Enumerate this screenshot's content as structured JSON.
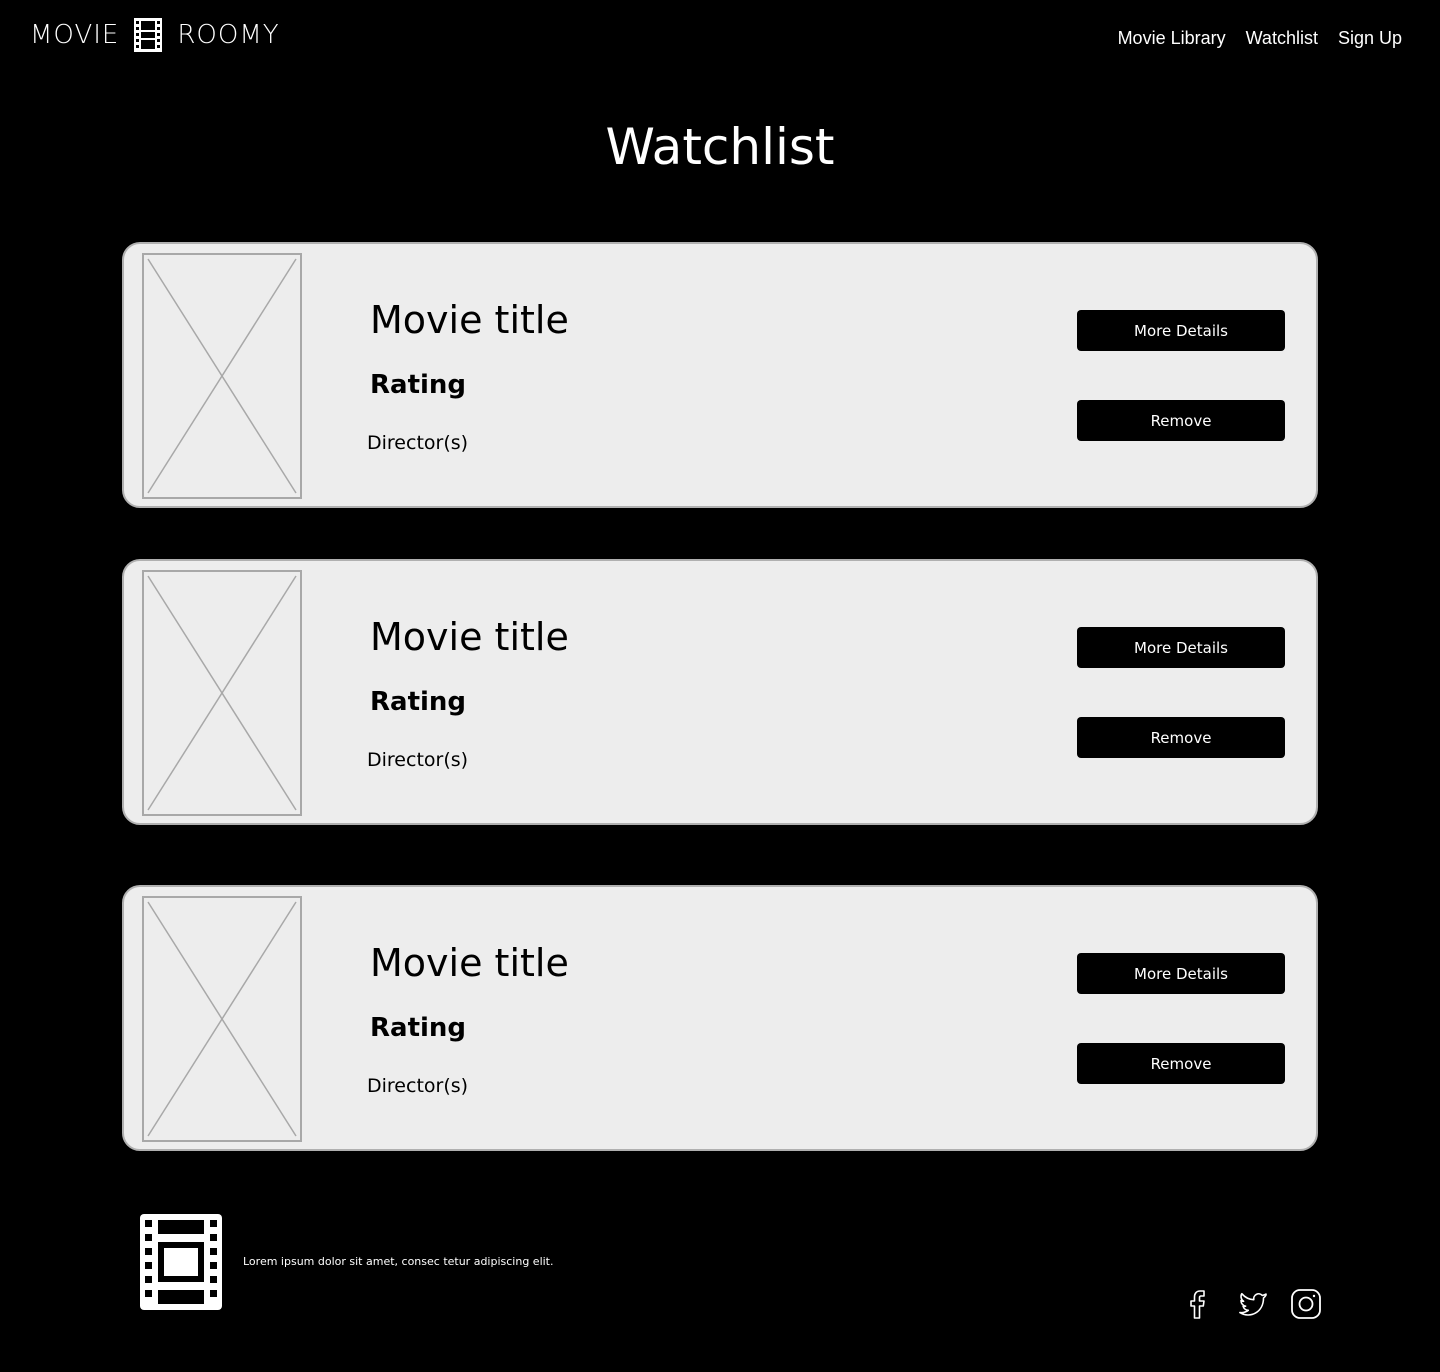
{
  "header": {
    "logo_left": "MOVIE",
    "logo_right": "ROOMY",
    "nav": [
      {
        "label": "Movie Library"
      },
      {
        "label": "Watchlist"
      },
      {
        "label": "Sign Up"
      }
    ]
  },
  "page": {
    "title": "Watchlist"
  },
  "movies": [
    {
      "title": "Movie title",
      "rating": "Rating",
      "directors": "Director(s)",
      "details_label": "More Details",
      "remove_label": "Remove"
    },
    {
      "title": "Movie title",
      "rating": "Rating",
      "directors": "Director(s)",
      "details_label": "More Details",
      "remove_label": "Remove"
    },
    {
      "title": "Movie title",
      "rating": "Rating",
      "directors": "Director(s)",
      "details_label": "More Details",
      "remove_label": "Remove"
    }
  ],
  "footer": {
    "text": "Lorem ipsum dolor sit amet, consec tetur adipiscing elit.",
    "socials": [
      "facebook-icon",
      "twitter-icon",
      "instagram-icon"
    ]
  },
  "colors": {
    "background": "#000000",
    "card": "#ededed",
    "button": "#000000"
  }
}
